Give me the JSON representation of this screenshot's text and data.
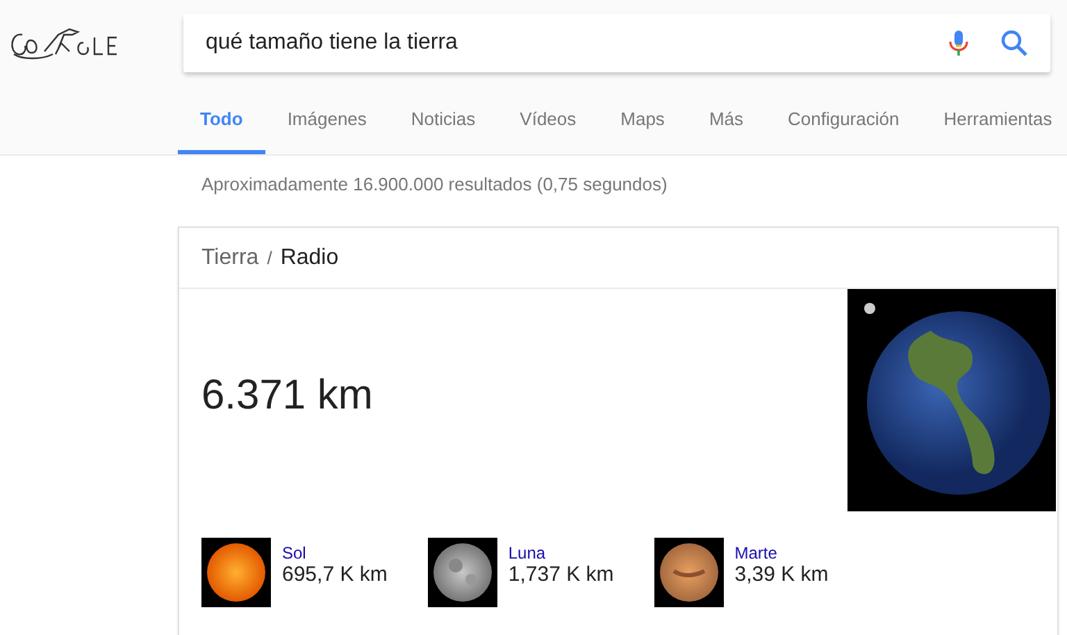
{
  "search": {
    "value": "qué tamaño tiene la tierra"
  },
  "tabs": [
    {
      "label": "Todo",
      "selected": true
    },
    {
      "label": "Imágenes",
      "selected": false
    },
    {
      "label": "Noticias",
      "selected": false
    },
    {
      "label": "Vídeos",
      "selected": false
    },
    {
      "label": "Maps",
      "selected": false
    },
    {
      "label": "Más",
      "selected": false
    },
    {
      "label": "Configuración",
      "selected": false
    },
    {
      "label": "Herramientas",
      "selected": false
    }
  ],
  "result_stats": "Aproximadamente 16.900.000 resultados (0,75 segundos)",
  "card": {
    "breadcrumb": [
      {
        "label": "Tierra",
        "kind": "link"
      },
      {
        "label": "/",
        "kind": "separator"
      },
      {
        "label": "Radio",
        "kind": "current"
      }
    ],
    "answer": "6.371 km",
    "related": [
      {
        "name": "Sol",
        "value": "695,7 K km",
        "kind": "sun"
      },
      {
        "name": "Luna",
        "value": "1,737 K km",
        "kind": "moon"
      },
      {
        "name": "Marte",
        "value": "3,39 K km",
        "kind": "mars"
      }
    ]
  }
}
